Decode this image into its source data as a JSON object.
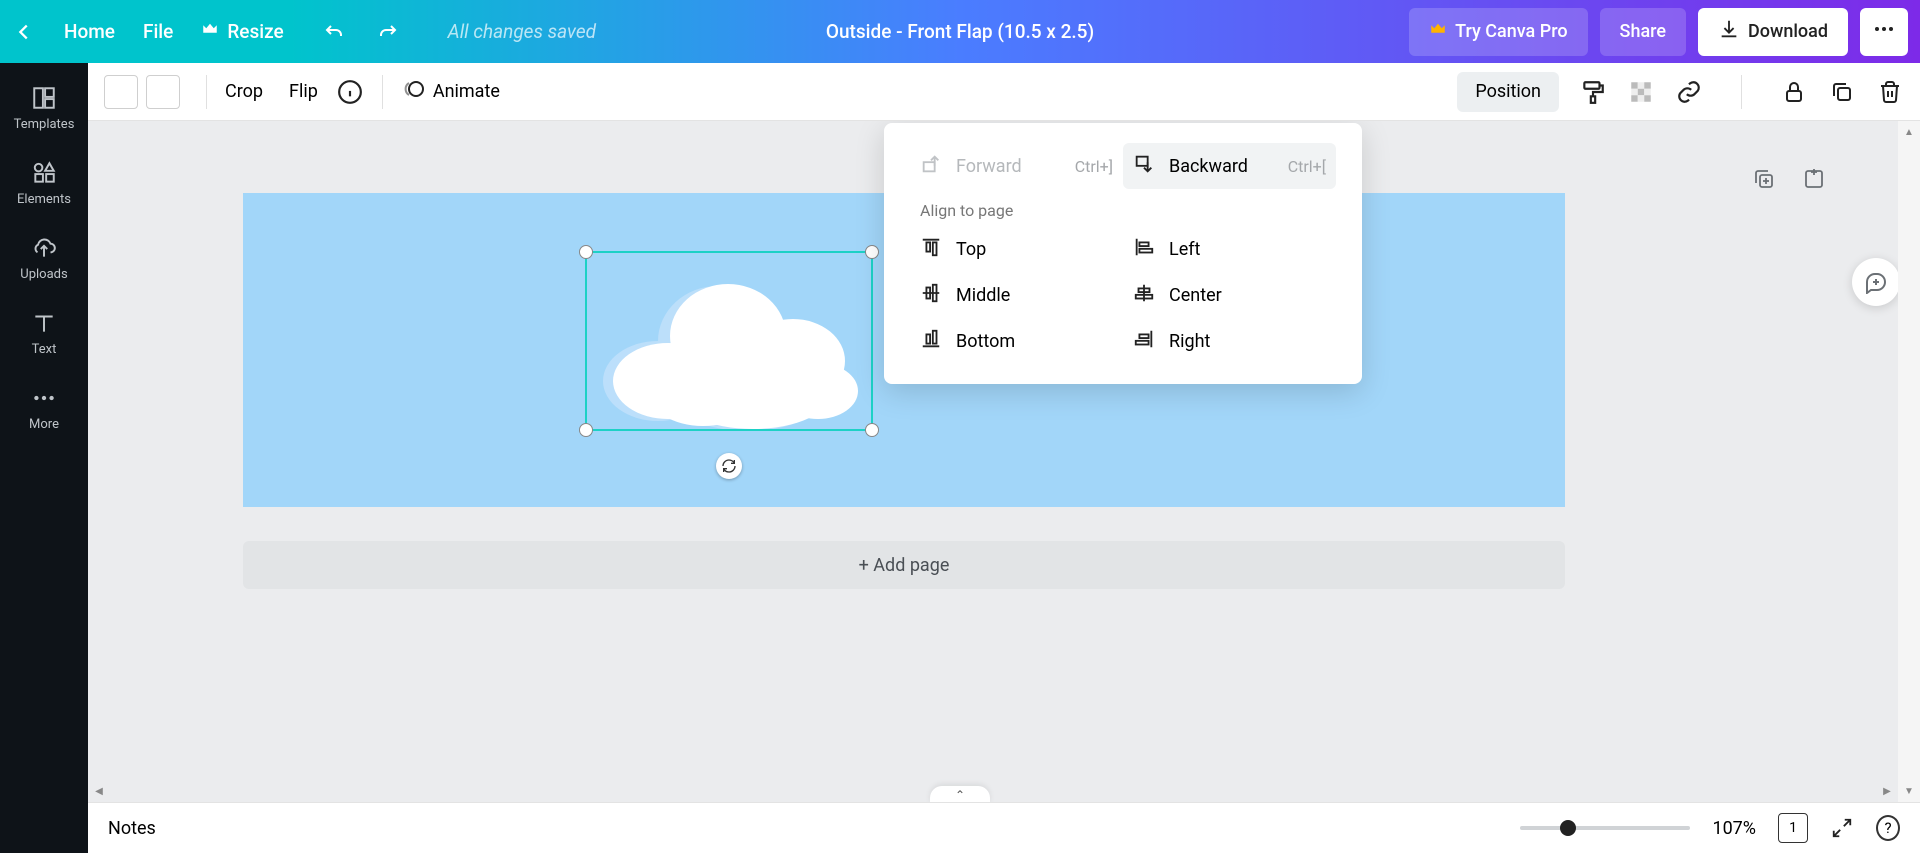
{
  "topbar": {
    "home": "Home",
    "file": "File",
    "resize": "Resize",
    "saved_status": "All changes saved",
    "doc_title": "Outside - Front Flap (10.5 x 2.5)",
    "try_pro": "Try Canva Pro",
    "share": "Share",
    "download": "Download"
  },
  "sidebar": {
    "templates": "Templates",
    "elements": "Elements",
    "uploads": "Uploads",
    "text": "Text",
    "more": "More"
  },
  "toolbar": {
    "crop": "Crop",
    "flip": "Flip",
    "animate": "Animate",
    "position": "Position"
  },
  "position_menu": {
    "forward": "Forward",
    "forward_key": "Ctrl+]",
    "backward": "Backward",
    "backward_key": "Ctrl+[",
    "align_label": "Align to page",
    "top": "Top",
    "middle": "Middle",
    "bottom": "Bottom",
    "left": "Left",
    "center": "Center",
    "right": "Right"
  },
  "canvas": {
    "add_page": "+ Add page",
    "bg_color": "#a2d6f9"
  },
  "bottombar": {
    "notes": "Notes",
    "zoom_pct": "107%",
    "page_number": "1"
  },
  "colors": {
    "selection": "#1dd1c6"
  }
}
